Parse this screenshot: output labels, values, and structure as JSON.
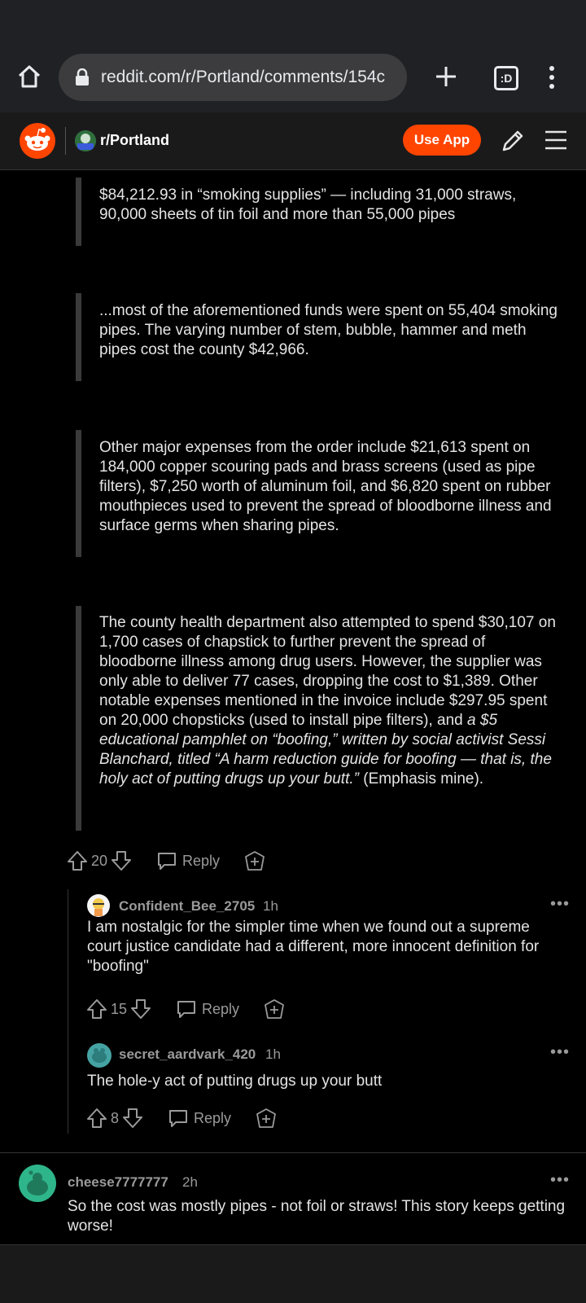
{
  "browser": {
    "url": "reddit.com/r/Portland/comments/154c",
    "tab_count": ":D"
  },
  "header": {
    "subreddit": "r/Portland",
    "use_app": "Use App"
  },
  "quotes": [
    "$84,212.93 in “smoking supplies” — including 31,000 straws, 90,000 sheets of tin foil and more than 55,000 pipes",
    "...most of the aforementioned funds were spent on 55,404 smoking pipes. The varying number of stem, bubble, hammer and meth pipes cost the county $42,966.",
    "Other major expenses from the order include $21,613 spent on 184,000 copper scouring pads and brass screens (used as pipe filters), $7,250 worth of aluminum foil, and $6,820 spent on rubber mouthpieces used to prevent the spread of bloodborne illness and surface germs when sharing pipes."
  ],
  "quote4": {
    "plain": "The county health department also attempted to spend $30,107 on 1,700 cases of chapstick to further prevent the spread of bloodborne illness among drug users. However, the supplier was only able to deliver 77 cases, dropping the cost to $1,389. Other notable expenses mentioned in the invoice include $297.95 spent on 20,000 chopsticks (used to install pipe filters), and ",
    "italic": "a $5 educational pamphlet on “boofing,” written by social activist Sessi Blanchard, titled “A harm reduction guide for boofing — that is, the holy act of putting drugs up your butt.”",
    "tail": " (Emphasis mine)."
  },
  "parent_actions": {
    "votes": "20",
    "reply": "Reply"
  },
  "comments": [
    {
      "username": "Confident_Bee_2705",
      "time": "1h",
      "more": "•••",
      "body": "I am nostalgic for the simpler time when we found out a supreme court justice candidate had a different, more innocent definition for \"boofing\"",
      "votes": "15",
      "reply": "Reply"
    },
    {
      "username": "secret_aardvark_420",
      "time": "1h",
      "more": "•••",
      "body": "The hole-y act of putting drugs up your butt",
      "votes": "8",
      "reply": "Reply"
    },
    {
      "username": "cheese7777777",
      "time": "2h",
      "more": "•••",
      "body": "So the cost was mostly pipes - not foil or straws! This story keeps getting worse!"
    }
  ],
  "colors": {
    "accent": "#ff4500",
    "background": "#000000",
    "header": "#1a1a1b",
    "muted_text": "#9a9a9a"
  },
  "icons": [
    "home-icon",
    "lock-icon",
    "plus-icon",
    "more-vertical-icon",
    "reddit-logo-icon",
    "pencil-icon",
    "menu-icon",
    "upvote-icon",
    "downvote-icon",
    "comment-icon",
    "award-icon"
  ]
}
